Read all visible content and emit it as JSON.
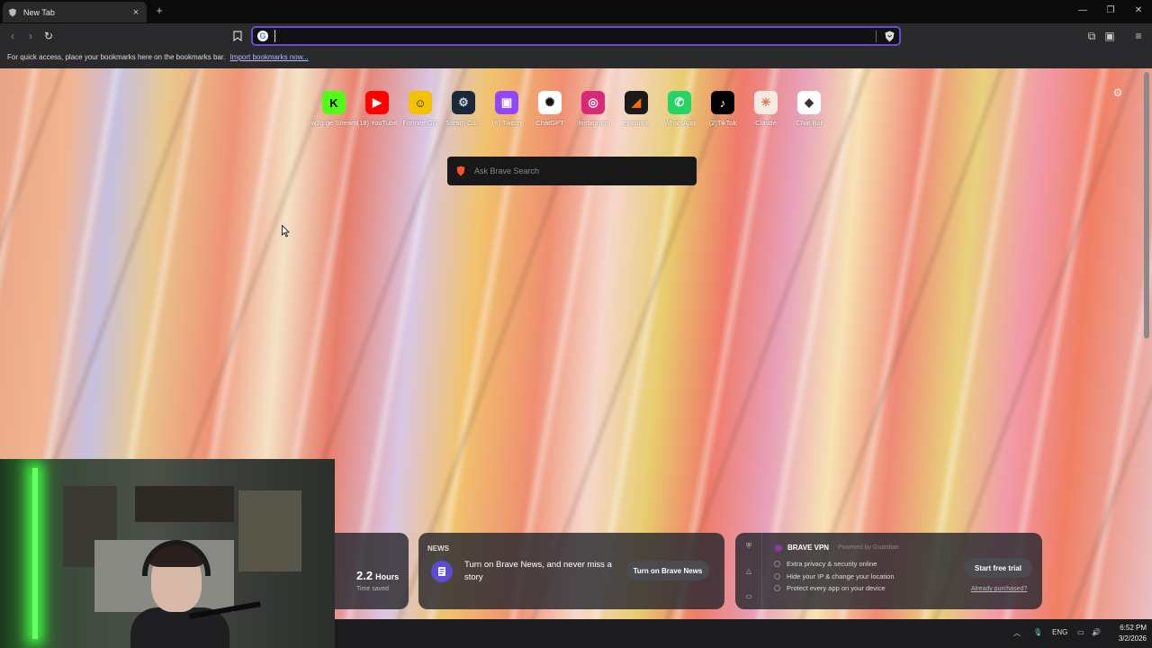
{
  "tab": {
    "title": "New Tab",
    "close": "×"
  },
  "toolbar": {
    "new_tab": "+",
    "address_value": "",
    "address_placeholder": ""
  },
  "bookmarks_bar": {
    "text": "For quick access, place your bookmarks here on the bookmarks bar.",
    "link": "Import bookmarks now..."
  },
  "top_sites": [
    {
      "label": "w2g.ge Stream",
      "icon": "kick-icon",
      "glyph": "K",
      "color": "#53fc18",
      "fg": "#000"
    },
    {
      "label": "(18) YouTube",
      "icon": "youtube-icon",
      "glyph": "▶",
      "color": "#ff0000",
      "fg": "#fff"
    },
    {
      "label": "Fortnite.GG",
      "icon": "fortnite-gg-icon",
      "glyph": "☺",
      "color": "#f2c200",
      "fg": "#222"
    },
    {
      "label": "Steam Co...",
      "icon": "steam-icon",
      "glyph": "⚙",
      "color": "#1b2838",
      "fg": "#c7d5e0"
    },
    {
      "label": "(6) Twitch",
      "icon": "twitch-icon",
      "glyph": "▣",
      "color": "#9146ff",
      "fg": "#fff"
    },
    {
      "label": "ChatGPT",
      "icon": "chatgpt-icon",
      "glyph": "✺",
      "color": "#ffffff",
      "fg": "#111"
    },
    {
      "label": "Instagram",
      "icon": "instagram-icon",
      "glyph": "◎",
      "color": "#d62976",
      "fg": "#fff"
    },
    {
      "label": "evaziune",
      "icon": "evaziune-icon",
      "glyph": "◢",
      "color": "#1a1a1a",
      "fg": "#ff6a00"
    },
    {
      "label": "WhatsApp",
      "icon": "whatsapp-icon",
      "glyph": "✆",
      "color": "#25d366",
      "fg": "#fff"
    },
    {
      "label": "(2)TikTok",
      "icon": "tiktok-icon",
      "glyph": "♪",
      "color": "#000000",
      "fg": "#fff"
    },
    {
      "label": "Claude",
      "icon": "claude-icon",
      "glyph": "✳",
      "color": "#f6e9e2",
      "fg": "#d97757"
    },
    {
      "label": "Chat Bot",
      "icon": "chatbot-icon",
      "glyph": "◆",
      "color": "#ffffff",
      "fg": "#333"
    }
  ],
  "search": {
    "placeholder": "Ask Brave Search"
  },
  "stats": {
    "value": "2.2",
    "unit": "Hours",
    "label": "Time saved"
  },
  "news": {
    "header": "NEWS",
    "message": "Turn on Brave News, and never miss a story",
    "button": "Turn on Brave News"
  },
  "vpn": {
    "title": "BRAVE VPN",
    "powered_by": "Powered by Guardian",
    "features": [
      "Extra privacy & security online",
      "Hide your IP & change your location",
      "Protect every app on your device"
    ],
    "button": "Start free trial",
    "link": "Already purchased?"
  },
  "taskbar": {
    "language": "ENG",
    "time": "6:52 PM",
    "date": "3/2/2026"
  },
  "colors": {
    "accent": "#6e49d6",
    "chrome": "#2a2a2d"
  }
}
